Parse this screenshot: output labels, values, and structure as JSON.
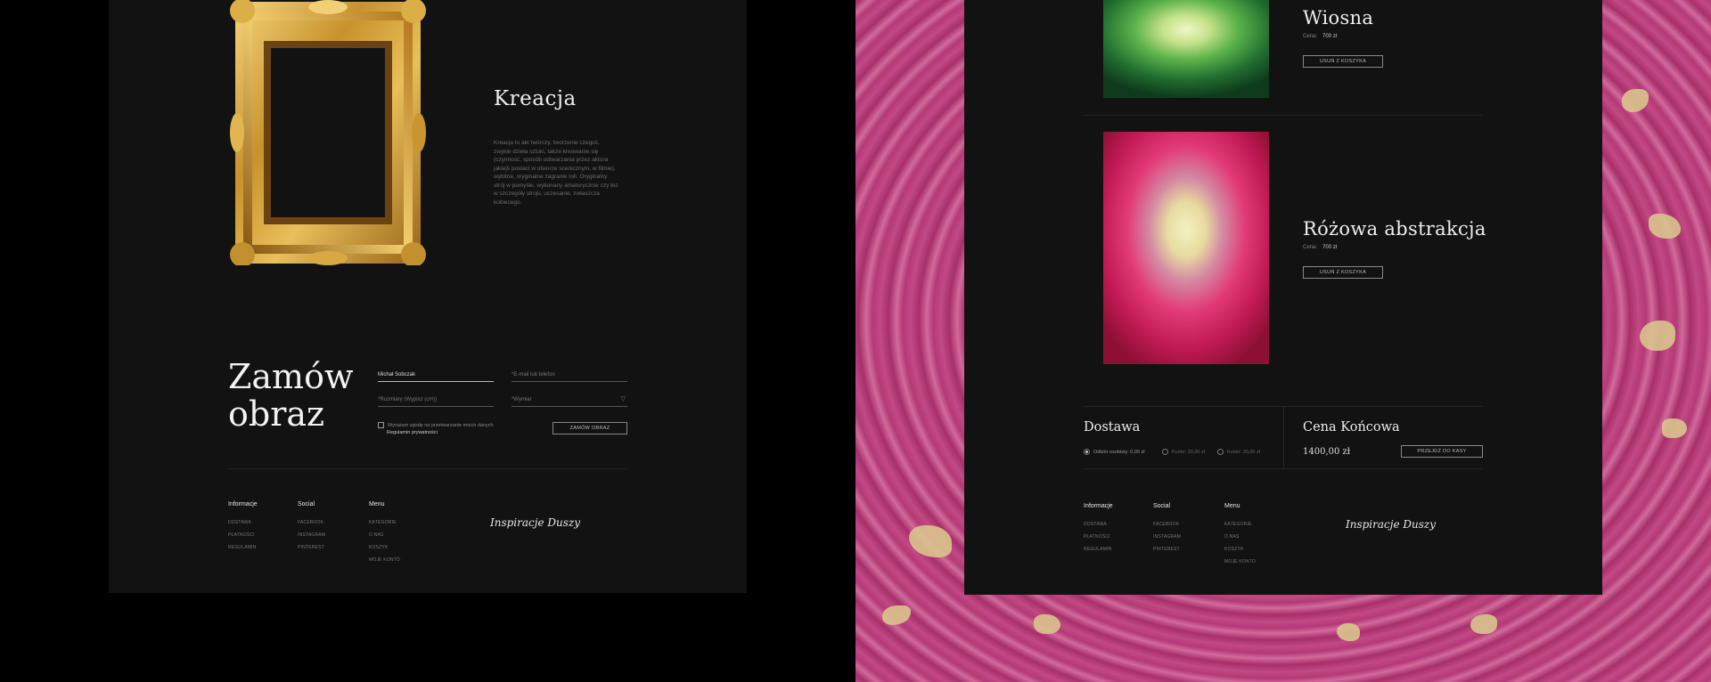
{
  "left": {
    "creation": {
      "title": "Kreacja",
      "description": "Kreacja to akt twórczy, tworzenie czegoś, zwykle dzieła sztuki, także kreowanie się (czynność, sposób odtwarzania przez aktora jakiejś postaci w utworze scenicznym, w filmie), wybitne, oryginalne zagranie roli. Oryginalny strój w pomyśle, wykonany amatorycznie czy też w szczegóły stroju, uczesanie, zwłaszcza kobiecego."
    },
    "order": {
      "title": "Zamów obraz",
      "fields": {
        "name": "Michał Sobczak",
        "email": "*E-mail lub telefon",
        "size": "*Rozmiary (Wypisz (cm))",
        "type": "*Wymiar"
      },
      "consent": "Wyrażam zgodę na przetwarzanie moich danych",
      "policy": "Regulamin prywatności",
      "submit": "ZAMÓW OBRAZ"
    },
    "footer": {
      "columns": [
        {
          "heading": "Informacje",
          "items": [
            "DOSTAWA",
            "PŁATNOŚCI",
            "REGULAMIN"
          ]
        },
        {
          "heading": "Social",
          "items": [
            "FACEBOOK",
            "INSTAGRAM",
            "PINTEREST"
          ]
        },
        {
          "heading": "Menu",
          "items": [
            "KATEGORIE",
            "O NAS",
            "KOSZYK",
            "MOJE KONTO"
          ]
        }
      ],
      "logo": "Inspiracje Duszy"
    }
  },
  "right": {
    "items": [
      {
        "title": "Wiosna",
        "price_label": "Cena:",
        "price": "700 zł",
        "remove": "USUŃ Z KOSZYKA"
      },
      {
        "title": "Różowa abstrakcja",
        "price_label": "Cena:",
        "price": "700 zł",
        "remove": "USUŃ Z KOSZYKA"
      }
    ],
    "delivery": {
      "title": "Dostawa",
      "options": [
        "Odbiór osobisty: 0,00 zł",
        "Kurier: 20,00 zł",
        "Kurier: 30,00 zł"
      ]
    },
    "summary": {
      "title": "Cena Końcowa",
      "total": "1400,00 zł",
      "checkout": "PRZEJDŹ DO KASY"
    },
    "footer": {
      "columns": [
        {
          "heading": "Informacje",
          "items": [
            "DOSTAWA",
            "PŁATNOŚCI",
            "REGULAMIN"
          ]
        },
        {
          "heading": "Social",
          "items": [
            "FACEBOOK",
            "INSTAGRAM",
            "PINTEREST"
          ]
        },
        {
          "heading": "Menu",
          "items": [
            "KATEGORIE",
            "O NAS",
            "KOSZYK",
            "MOJE KONTO"
          ]
        }
      ],
      "logo": "Inspiracje Duszy"
    }
  },
  "colors": {
    "panel": "#121212",
    "gold": "#c9962f",
    "pink": "#b43a78"
  }
}
